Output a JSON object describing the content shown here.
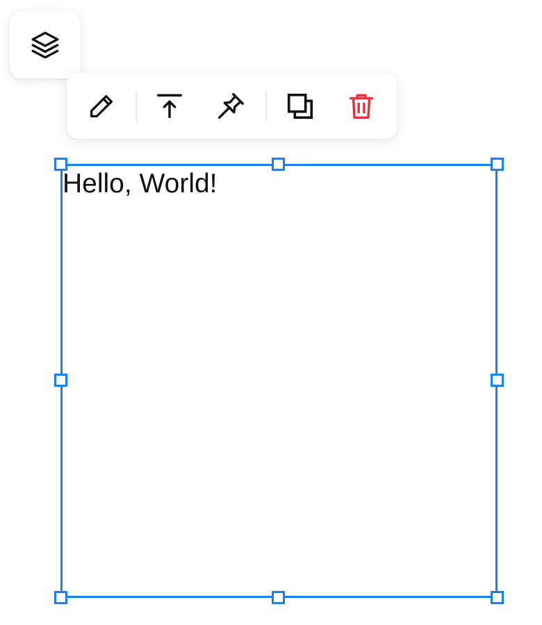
{
  "canvas": {
    "text_element": {
      "content": "Hello, World!"
    }
  },
  "icons": {
    "layers": "layers-icon",
    "edit": "pencil-icon",
    "bring_to_front": "bring-to-front-icon",
    "pin": "pin-icon",
    "duplicate": "duplicate-icon",
    "delete": "trash-icon"
  },
  "colors": {
    "selection": "#1a7ff0",
    "delete": "#e0343f",
    "icon": "#111111"
  }
}
